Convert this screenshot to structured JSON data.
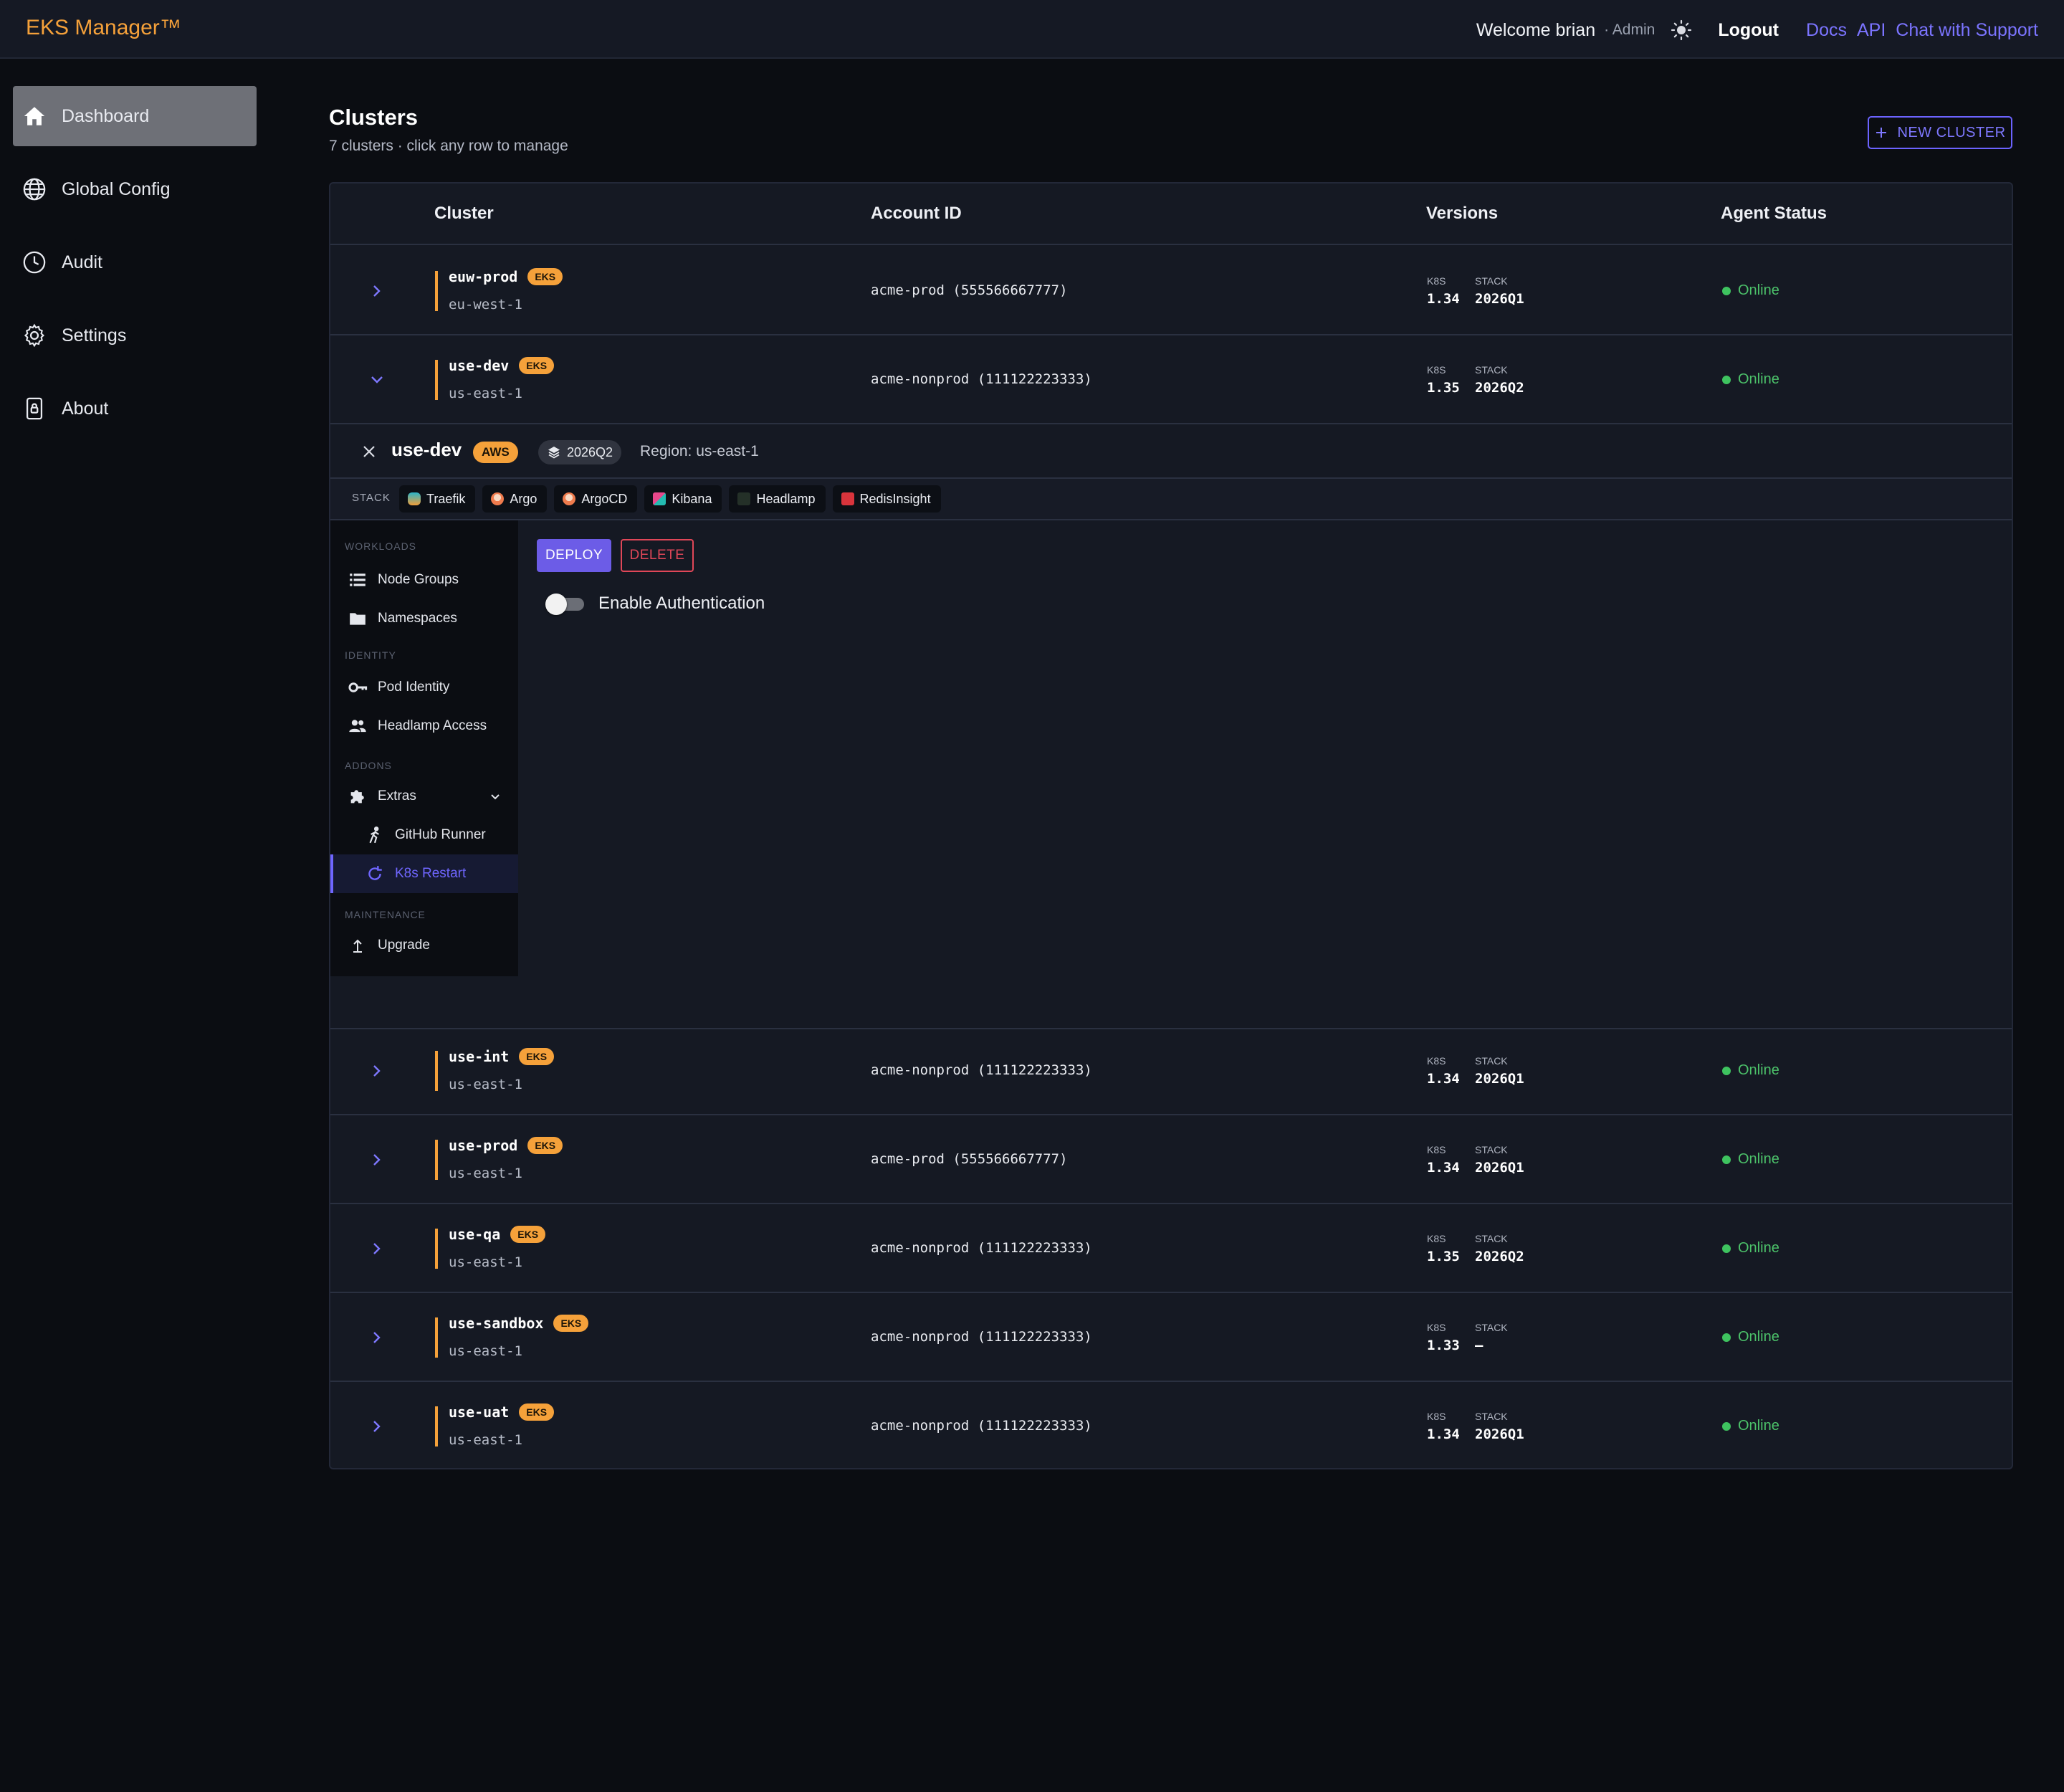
{
  "topbar": {
    "brand": "EKS Manager™",
    "welcome": "Welcome brian",
    "role": "· Admin",
    "theme_icon": "sun-icon",
    "logout": "Logout",
    "links": [
      "Docs",
      "API",
      "Chat with Support"
    ]
  },
  "sidebar": {
    "items": [
      {
        "label": "Dashboard",
        "icon": "home-icon",
        "active": true
      },
      {
        "label": "Global Config",
        "icon": "globe-icon"
      },
      {
        "label": "Audit",
        "icon": "clock-icon"
      },
      {
        "label": "Settings",
        "icon": "gear-icon"
      },
      {
        "label": "About",
        "icon": "lock-icon"
      }
    ]
  },
  "page": {
    "title": "Clusters",
    "subtitle": "7 clusters · click any row to manage",
    "new_cluster": "NEW CLUSTER"
  },
  "table": {
    "headers": [
      "Cluster",
      "Account ID",
      "Versions",
      "Agent Status"
    ],
    "k8s_label": "K8S",
    "stack_label": "STACK",
    "rows": [
      {
        "name": "euw-prod",
        "badge": "EKS",
        "region": "eu-west-1",
        "account": "acme-prod (555566667777)",
        "k8s": "1.34",
        "stack": "2026Q1",
        "status": "Online",
        "expanded": false
      },
      {
        "name": "use-dev",
        "badge": "EKS",
        "region": "us-east-1",
        "account": "acme-nonprod (111122223333)",
        "k8s": "1.35",
        "stack": "2026Q2",
        "status": "Online",
        "expanded": true
      },
      {
        "name": "use-int",
        "badge": "EKS",
        "region": "us-east-1",
        "account": "acme-nonprod (111122223333)",
        "k8s": "1.34",
        "stack": "2026Q1",
        "status": "Online",
        "expanded": false
      },
      {
        "name": "use-prod",
        "badge": "EKS",
        "region": "us-east-1",
        "account": "acme-prod (555566667777)",
        "k8s": "1.34",
        "stack": "2026Q1",
        "status": "Online",
        "expanded": false
      },
      {
        "name": "use-qa",
        "badge": "EKS",
        "region": "us-east-1",
        "account": "acme-nonprod (111122223333)",
        "k8s": "1.35",
        "stack": "2026Q2",
        "status": "Online",
        "expanded": false
      },
      {
        "name": "use-sandbox",
        "badge": "EKS",
        "region": "us-east-1",
        "account": "acme-nonprod (111122223333)",
        "k8s": "1.33",
        "stack": "—",
        "status": "Online",
        "expanded": false
      },
      {
        "name": "use-uat",
        "badge": "EKS",
        "region": "us-east-1",
        "account": "acme-nonprod (111122223333)",
        "k8s": "1.34",
        "stack": "2026Q1",
        "status": "Online",
        "expanded": false
      }
    ]
  },
  "panel": {
    "name": "use-dev",
    "provider_badge": "AWS",
    "stack_version": "2026Q2",
    "region": "Region: us-east-1",
    "stack_label": "STACK",
    "tools": [
      "Traefik",
      "Argo",
      "ArgoCD",
      "Kibana",
      "Headlamp",
      "RedisInsight"
    ],
    "subnav": {
      "sections": [
        "WORKLOADS",
        "IDENTITY",
        "ADDONS",
        "MAINTENANCE"
      ],
      "items": [
        {
          "label": "Node Groups",
          "icon": "list-icon"
        },
        {
          "label": "Namespaces",
          "icon": "folder-icon"
        },
        {
          "label": "Pod Identity",
          "icon": "key-icon"
        },
        {
          "label": "Headlamp Access",
          "icon": "people-icon"
        },
        {
          "label": "Extras",
          "icon": "puzzle-icon"
        },
        {
          "label": "GitHub Runner",
          "icon": "runner-icon"
        },
        {
          "label": "K8s Restart",
          "icon": "refresh-icon",
          "active": true
        },
        {
          "label": "Upgrade",
          "icon": "upload-icon"
        }
      ]
    },
    "deploy": "DEPLOY",
    "delete": "DELETE",
    "toggle_label": "Enable Authentication",
    "toggle_on": false
  },
  "colors": {
    "accent_orange": "#f5a13a",
    "accent_purple": "#6c5ce7",
    "link_purple": "#7b74ff",
    "status_green": "#3ec35f",
    "danger_red": "#e04758"
  }
}
